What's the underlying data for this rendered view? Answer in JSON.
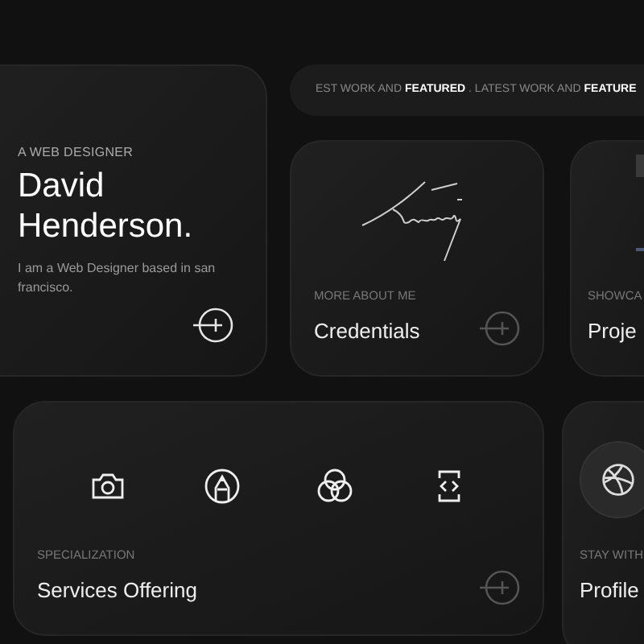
{
  "hero": {
    "eyebrow": "A WEB DESIGNER",
    "name": "David Henderson.",
    "bio": "I am a Web Designer based in san francisco."
  },
  "marquee": {
    "text": "EST WORK AND **FEATURED** . LATEST WORK AND **FEATURE**"
  },
  "cards": [
    {
      "kind": "signature",
      "eyebrow": "MORE ABOUT ME",
      "title": "Credentials"
    },
    {
      "kind": "project",
      "eyebrow": "SHOWCA",
      "title": "Proje"
    }
  ],
  "services": {
    "eyebrow": "SPECIALIZATION",
    "title": "Services Offering"
  },
  "profiles": {
    "eyebrow": "STAY WITH",
    "title": "Profile"
  }
}
